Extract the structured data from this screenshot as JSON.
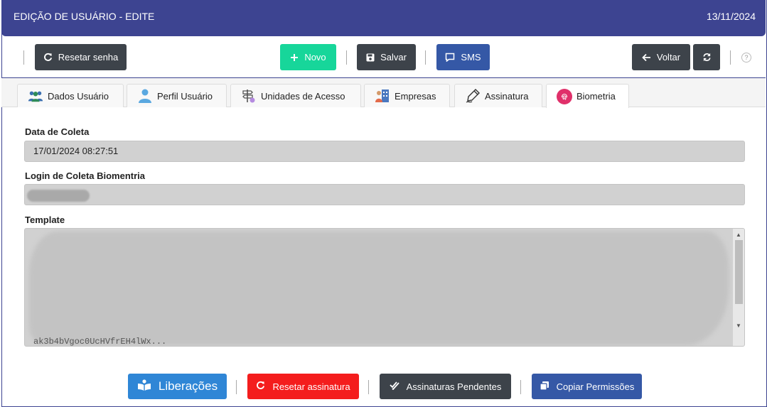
{
  "window": {
    "title": "EDIÇÃO DE USUÁRIO - EDITE",
    "date": "13/11/2024"
  },
  "toolbar": {
    "reset_password": "Resetar senha",
    "new": "Novo",
    "save": "Salvar",
    "sms": "SMS",
    "back": "Voltar",
    "help": "?"
  },
  "tabs": [
    {
      "label": "Dados Usuário",
      "icon": "users-icon"
    },
    {
      "label": "Perfil Usuário",
      "icon": "user-profile-icon"
    },
    {
      "label": "Unidades de Acesso",
      "icon": "signpost-icon"
    },
    {
      "label": "Empresas",
      "icon": "building-icon"
    },
    {
      "label": "Assinatura",
      "icon": "pen-icon"
    },
    {
      "label": "Biometria",
      "icon": "fingerprint-icon",
      "active": true
    }
  ],
  "form": {
    "collection_date_label": "Data de Coleta",
    "collection_date_value": "17/01/2024 08:27:51",
    "collection_login_label": "Login de Coleta Biomentria",
    "template_label": "Template",
    "template_visible_text": "ak3b4bVgoc0UcHVfrEH4lWx..."
  },
  "footer": {
    "releases": "Liberações",
    "reset_signature": "Resetar assinatura",
    "pending_signatures": "Assinaturas Pendentes",
    "copy_permissions": "Copiar Permissões"
  },
  "colors": {
    "header": "#3d4491",
    "dark_button": "#3d434a",
    "new_button": "#17d69a",
    "blue_button": "#3558a6",
    "releases_button": "#2f86d6",
    "reset_signature_button": "#f41d1d",
    "fingerprint_badge": "#e0306a"
  }
}
